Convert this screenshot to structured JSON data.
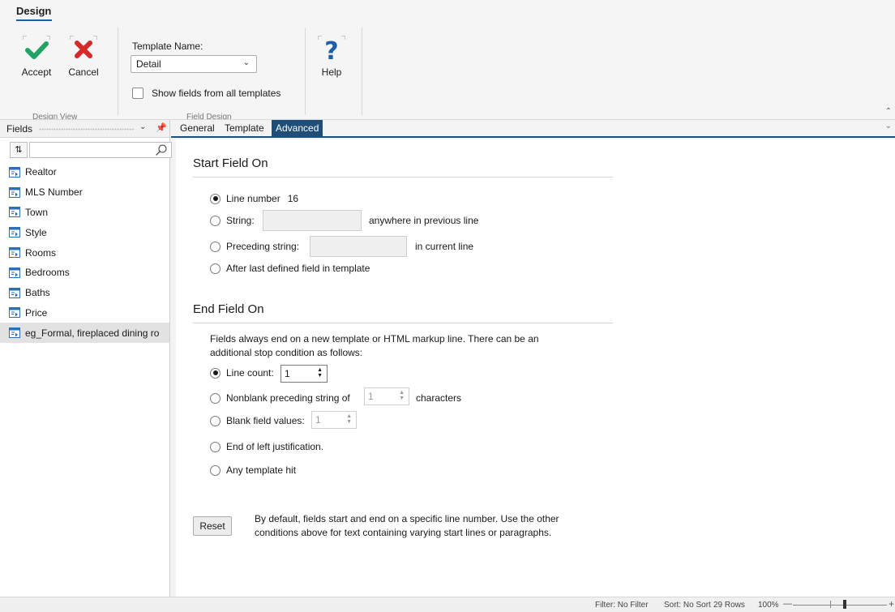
{
  "ribbon": {
    "tab": "Design",
    "accept_label": "Accept",
    "cancel_label": "Cancel",
    "help_label": "Help",
    "template_name_label": "Template Name:",
    "template_name_value": "Detail",
    "show_fields_label": "Show fields from all templates",
    "show_fields_checked": false,
    "group1_label": "Design View",
    "group2_label": "Field Design"
  },
  "fields_pane": {
    "title": "Fields",
    "search_placeholder": "",
    "items": [
      {
        "label": "Realtor"
      },
      {
        "label": "MLS Number"
      },
      {
        "label": "Town"
      },
      {
        "label": "Style"
      },
      {
        "label": "Rooms"
      },
      {
        "label": "Bedrooms"
      },
      {
        "label": "Baths"
      },
      {
        "label": "Price"
      },
      {
        "label": "eg_Formal, fireplaced dining ro",
        "selected": true
      }
    ]
  },
  "tabs": [
    {
      "label": "General"
    },
    {
      "label": "Template"
    },
    {
      "label": "Advanced",
      "active": true
    }
  ],
  "start_field": {
    "title": "Start Field On",
    "options": {
      "line_number_label": "Line number",
      "line_number_value": "16",
      "string_label": "String:",
      "string_suffix": "anywhere in previous line",
      "preceding_label": "Preceding string:",
      "preceding_suffix": "in current line",
      "after_last_label": "After last defined field in template"
    },
    "selected": "line_number"
  },
  "end_field": {
    "title": "End Field On",
    "note_line1": "Fields always end on a new template or HTML markup line.  There can be an",
    "note_line2": "additional stop condition as follows:",
    "line_count_label": "Line count:",
    "line_count_value": "1",
    "nonblank_label": "Nonblank preceding string of",
    "nonblank_value": "1",
    "nonblank_suffix": "characters",
    "blank_label": "Blank field values:",
    "blank_value": "1",
    "end_left_label": "End of left justification.",
    "any_template_label": "Any template hit",
    "selected": "line_count"
  },
  "reset": {
    "label": "Reset",
    "hint_line1": "By default, fields start and end on a specific line number.  Use the other",
    "hint_line2": "conditions above for text containing varying start lines or paragraphs."
  },
  "status": {
    "filter": "Filter: No Filter",
    "sort": "Sort: No Sort",
    "rows": "29 Rows",
    "zoom": "100%"
  },
  "colors": {
    "accent": "#1f4e79",
    "accept_green": "#21a366",
    "cancel_red": "#d42a2a",
    "help_blue": "#1f5fa8"
  }
}
